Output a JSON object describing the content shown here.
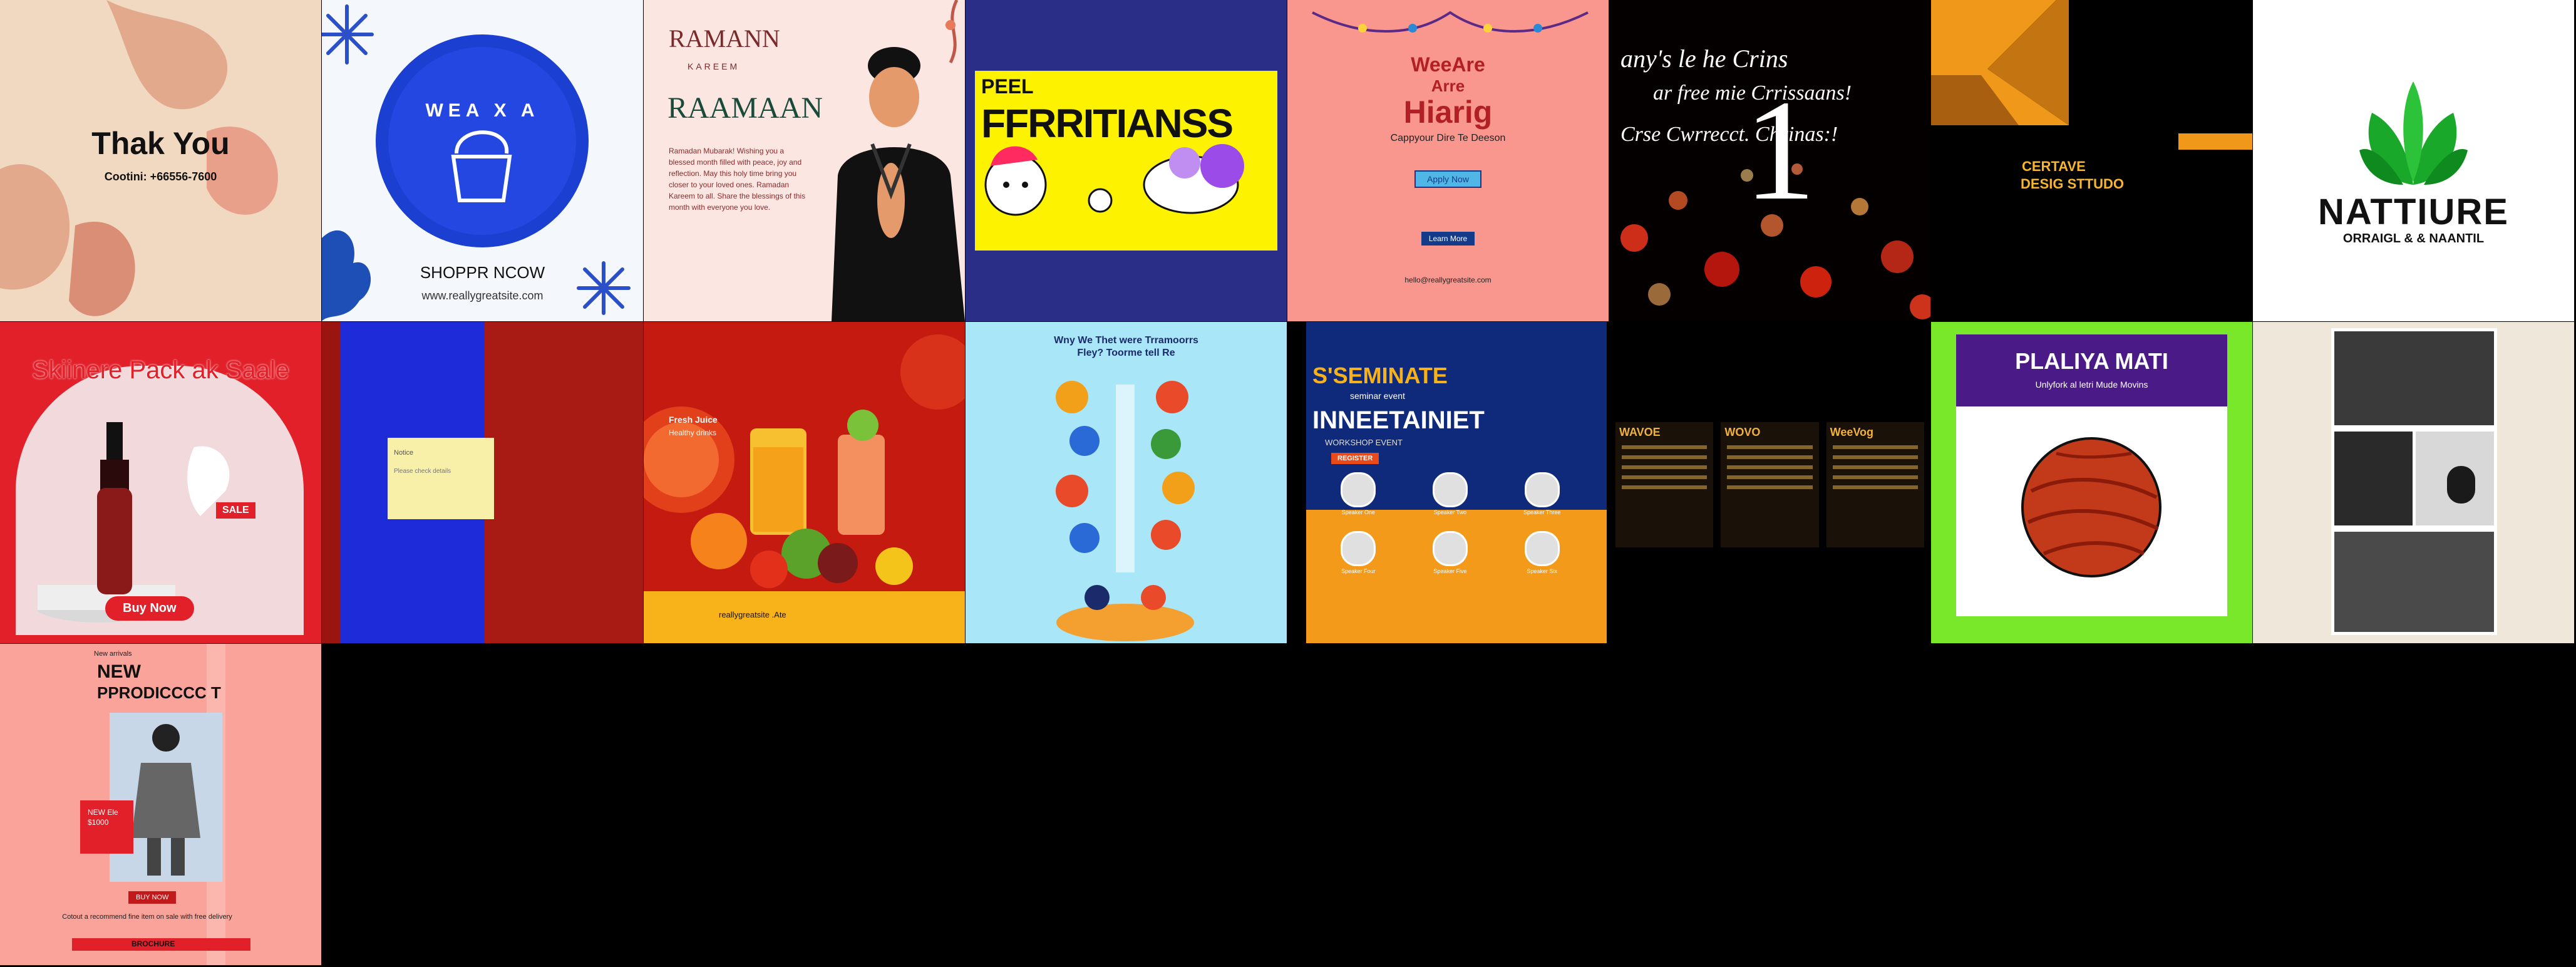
{
  "tiles": {
    "thank_you": {
      "title": "Thak You",
      "contact": "Cootini: +66556-7600"
    },
    "shop": {
      "badge_text": "WEA X A",
      "title": "SHOPPR NCOW",
      "url": "www.reallygreatsite.com"
    },
    "ramadan": {
      "small_title": "RAMANN",
      "small_sub": "KAREEM",
      "title": "RAAMAAN",
      "body": "Ramadan Mubarak! Wishing you a blessed month filled with peace, joy and reflection. May this holy time bring you closer to your loved ones. Ramadan Kareem to all. Share the blessings of this month with everyone you love."
    },
    "friendship": {
      "small": "PEEL",
      "title": "FFRRITIANSS"
    },
    "hiring": {
      "line1": "WeeAre",
      "line2": "Arre",
      "line3": "Hiarig",
      "sub": "Cappyour Dire Te Deeson",
      "apply": "Apply Now",
      "more": "Learn More",
      "footer": "hello@reallygreatsite.com"
    },
    "christmas": {
      "line1": "any's le he Crins",
      "line2": "ar free mie Crrissaans!",
      "line3": "Crse Cwrrecct. Chrinas:!",
      "big": "1"
    },
    "creative": {
      "line1": "CERTAVE",
      "line2": "DESIG STTUDO"
    },
    "nature": {
      "title": "NATTIURE",
      "sub": "ORRAIGL & & NAANTIL"
    },
    "skincare": {
      "title": "Skiinere Pack ak Saale",
      "badge": "SALE",
      "buy": "Buy Now"
    },
    "blue_red": {
      "note_title": "Notice",
      "note_line": "Please check details"
    },
    "juice": {
      "title": "Fresh Juice",
      "line": "Healthy drinks",
      "footer": "reallygreatsite  .Ate"
    },
    "infographic": {
      "title": "Wny We Thet were Trramoorrs Fley? Toorme tell Re"
    },
    "seminar": {
      "top": "S'SEMINATE",
      "sub": "seminar event",
      "title": "INNEETAINIET",
      "note": "WORKSHOP EVENT",
      "cta": "REGISTER",
      "speakers": [
        "Speaker One",
        "Speaker Two",
        "Speaker Three",
        "Speaker Four",
        "Speaker Five",
        "Speaker Six"
      ]
    },
    "menu": {
      "headings": [
        "WAVOE",
        "WOVO",
        "WeeVog"
      ]
    },
    "football": {
      "title": "PLALIYA MATI",
      "sub": "Unlyfork al letri Mude Movins"
    },
    "product": {
      "small": "New arrivals",
      "line1": "NEW",
      "line2": "PPRODICCCC T",
      "price1": "NEW Ele",
      "price2": "$1000",
      "buy": "BUY NOW",
      "body": "Cotout a recommend fine item on sale with free delivery",
      "footer": "BROCHURE"
    }
  }
}
